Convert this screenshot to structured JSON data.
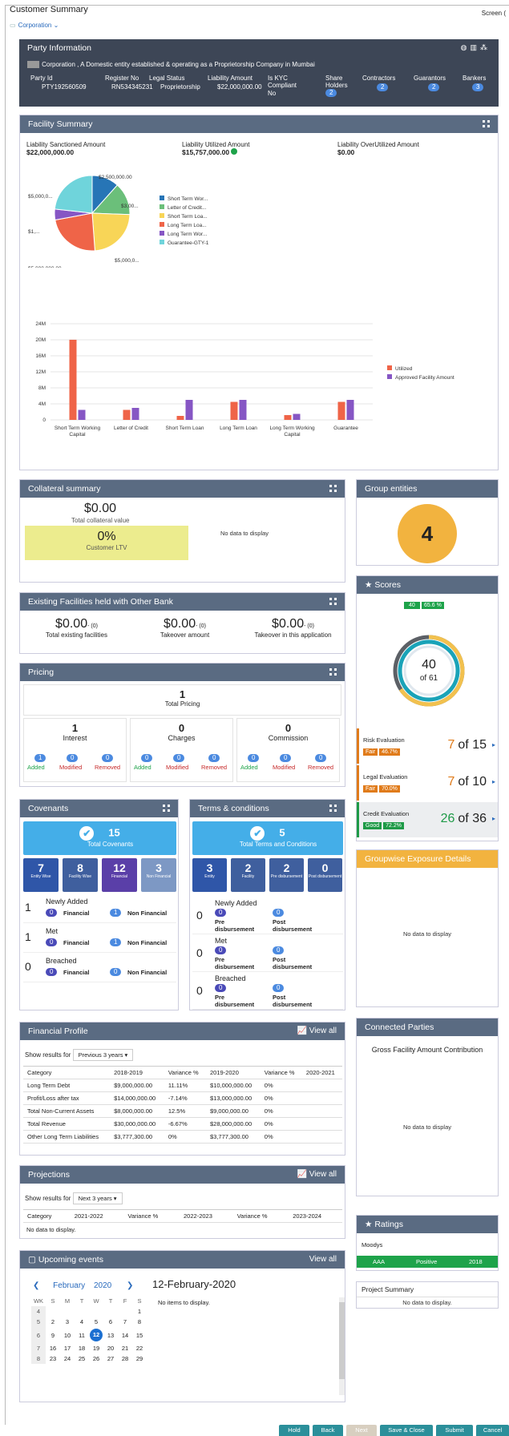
{
  "header": {
    "title": "Customer Summary",
    "screen_label": "Screen (",
    "breadcrumb": "Corporation"
  },
  "party": {
    "title": "Party Information",
    "description": "Corporation , A Domestic entity established & operating as a Proprietorship Company in Mumbai",
    "party_id_label": "Party Id",
    "party_id": "PTY192560509",
    "register_label": "Register No",
    "register_no": "RN534345231",
    "legal_label": "Legal Status",
    "legal_status": "Proprietorship",
    "liability_label": "Liability Amount",
    "liability_amount": "$22,000,000.00",
    "kyc_label": "Is KYC Compliant",
    "kyc_value": "No",
    "share_label": "Share Holders",
    "share_count": "2",
    "contractors_label": "Contractors",
    "contractors_count": "2",
    "guarantors_label": "Guarantors",
    "guarantors_count": "2",
    "bankers_label": "Bankers",
    "bankers_count": "3"
  },
  "facility": {
    "title": "Facility Summary",
    "sanctioned_label": "Liability Sanctioned Amount",
    "sanctioned": "$22,000,000.00",
    "utilized_label": "Liability Utilized Amount",
    "utilized": "$15,757,000.00",
    "over_label": "Liability OverUtilized Amount",
    "over": "$0.00"
  },
  "chart_data": [
    {
      "type": "pie",
      "categories": [
        "Short Term Wor...",
        "Letter of Credit...",
        "Short Term Loa...",
        "Long Term Loa...",
        "Long Term Wor...",
        "Guarantee-GTY-1"
      ],
      "values": [
        2500000,
        3000000,
        5000000,
        5000000,
        1000000,
        5000000
      ],
      "data_labels": [
        "$2,500,000.00",
        "$3,00...",
        "$5,000,0...",
        "$5,000,000.00",
        "$1,...",
        "$5,000,0..."
      ],
      "colors": [
        "#2775b6",
        "#6bbf7a",
        "#f8d557",
        "#ef6448",
        "#8656c4",
        "#6fd4db"
      ]
    },
    {
      "type": "bar",
      "categories": [
        "Short Term Working Capital",
        "Letter of Credit",
        "Short Term Loan",
        "Long Term Loan",
        "Long Term Working Capital",
        "Guarantee"
      ],
      "series": [
        {
          "name": "Utilized",
          "values": [
            20000000,
            2500000,
            1000000,
            4500000,
            1200000,
            4500000
          ],
          "color": "#ef6448"
        },
        {
          "name": "Approved Facility Amount",
          "values": [
            2500000,
            3000000,
            5000000,
            5000000,
            1500000,
            5000000
          ],
          "color": "#8656c4"
        }
      ],
      "yticks": [
        "0",
        "4M",
        "8M",
        "12M",
        "16M",
        "20M",
        "24M"
      ],
      "ylim": [
        0,
        24000000
      ]
    }
  ],
  "collateral": {
    "title": "Collateral summary",
    "value": "$0.00",
    "value_label": "Total collateral value",
    "ltv": "0%",
    "ltv_label": "Customer LTV",
    "no_data": "No data to display"
  },
  "group": {
    "title": "Group entities",
    "count": "4"
  },
  "existing": {
    "title": "Existing Facilities held with Other Bank",
    "items": [
      {
        "amount": "$0.00",
        "count": "- (0)",
        "label": "Total existing facilities"
      },
      {
        "amount": "$0.00",
        "count": "- (0)",
        "label": "Takeover amount"
      },
      {
        "amount": "$0.00",
        "count": "- (0)",
        "label": "Takeover in this application"
      }
    ]
  },
  "scores": {
    "title": "Scores",
    "chip_value": "40",
    "chip_pct": "65.6 %",
    "score": "40",
    "of": "of 61",
    "rows": [
      {
        "label": "Risk Evaluation",
        "grade": "Fair",
        "pct": "46.7%",
        "value": "7",
        "of": "of 15",
        "color": "#e07b1a"
      },
      {
        "label": "Legal Evaluation",
        "grade": "Fair",
        "pct": "70.0%",
        "value": "7",
        "of": "of 10",
        "color": "#e07b1a"
      },
      {
        "label": "Credit Evaluation",
        "grade": "Good",
        "pct": "72.2%",
        "value": "26",
        "of": "of 36",
        "color": "#1e9a47"
      }
    ]
  },
  "pricing": {
    "title": "Pricing",
    "total": "1",
    "total_label": "Total Pricing",
    "cols": [
      {
        "value": "1",
        "label": "Interest",
        "a": "1",
        "m": "0",
        "r": "0"
      },
      {
        "value": "0",
        "label": "Charges",
        "a": "0",
        "m": "0",
        "r": "0"
      },
      {
        "value": "0",
        "label": "Commission",
        "a": "0",
        "m": "0",
        "r": "0"
      }
    ],
    "added": "Added",
    "modified": "Modified",
    "removed": "Removed"
  },
  "covenants": {
    "title": "Covenants",
    "total": "15",
    "total_label": "Total Covenants",
    "tiles": [
      {
        "value": "7",
        "label": "Entity Wise",
        "color": "#2f56a8"
      },
      {
        "value": "8",
        "label": "Facility Wise",
        "color": "#3f5f9e"
      },
      {
        "value": "12",
        "label": "Financial",
        "color": "#5a3fa8"
      },
      {
        "value": "3",
        "label": "Non Financial",
        "color": "#7d98c4"
      }
    ],
    "rows": [
      {
        "num": "1",
        "label": "Newly Added",
        "f": "0",
        "fl": "Financial",
        "n": "1",
        "nl": "Non Financial"
      },
      {
        "num": "1",
        "label": "Met",
        "f": "0",
        "fl": "Financial",
        "n": "1",
        "nl": "Non Financial"
      },
      {
        "num": "0",
        "label": "Breached",
        "f": "0",
        "fl": "Financial",
        "n": "0",
        "nl": "Non Financial"
      }
    ]
  },
  "terms": {
    "title": "Terms & conditions",
    "total": "5",
    "total_label": "Total Terms and Conditions",
    "tiles": [
      {
        "value": "3",
        "label": "Entity",
        "color": "#2f56a8"
      },
      {
        "value": "2",
        "label": "Facility",
        "color": "#3f5f9e"
      },
      {
        "value": "2",
        "label": "Pre disbursement",
        "color": "#3f5f9e"
      },
      {
        "value": "0",
        "label": "Post disbursement",
        "color": "#3f5f9e"
      }
    ],
    "rows": [
      {
        "num": "0",
        "label": "Newly Added",
        "p": "0",
        "pl": "Pre disbursement",
        "q": "0",
        "ql": "Post disbursement"
      },
      {
        "num": "0",
        "label": "Met",
        "p": "0",
        "pl": "Pre disbursement",
        "q": "0",
        "ql": "Post disbursement"
      },
      {
        "num": "0",
        "label": "Breached",
        "p": "0",
        "pl": "Pre disbursement",
        "q": "0",
        "ql": "Post disbursement"
      }
    ]
  },
  "groupwise": {
    "title": "Groupwise Exposure Details",
    "no_data": "No data to display"
  },
  "financial": {
    "title": "Financial Profile",
    "view_all": "View all",
    "show_label": "Show results for",
    "period": "Previous 3 years",
    "headers": [
      "Category",
      "2018-2019",
      "Variance %",
      "2019-2020",
      "Variance %",
      "2020-2021"
    ],
    "rows": [
      [
        "Long Term Debt",
        "$9,000,000.00",
        "11.11%",
        "$10,000,000.00",
        "0%",
        ""
      ],
      [
        "Profit/Loss after tax",
        "$14,000,000.00",
        "-7.14%",
        "$13,000,000.00",
        "0%",
        ""
      ],
      [
        "Total Non-Current Assets",
        "$8,000,000.00",
        "12.5%",
        "$9,000,000.00",
        "0%",
        ""
      ],
      [
        "Total Revenue",
        "$30,000,000.00",
        "-6.67%",
        "$28,000,000.00",
        "0%",
        ""
      ],
      [
        "Other Long Term Liabilities",
        "$3,777,300.00",
        "0%",
        "$3,777,300.00",
        "0%",
        ""
      ]
    ]
  },
  "connected": {
    "title": "Connected Parties",
    "subtitle": "Gross Facility Amount Contribution",
    "no_data": "No data to display"
  },
  "projections": {
    "title": "Projections",
    "view_all": "View all",
    "show_label": "Show results for",
    "period": "Next 3 years",
    "headers": [
      "Category",
      "2021-2022",
      "Variance %",
      "2022-2023",
      "Variance %",
      "2023-2024"
    ],
    "no_data": "No data to display."
  },
  "ratings": {
    "title": "Ratings",
    "agency": "Moodys",
    "grade": "AAA",
    "outlook": "Positive",
    "year": "2018"
  },
  "project": {
    "title": "Project Summary",
    "no_data": "No data to display."
  },
  "events": {
    "title": "Upcoming events",
    "view_all": "View all",
    "month": "February",
    "year": "2020",
    "date": "12-February-2020",
    "no_items": "No items to display.",
    "dow": [
      "WK",
      "S",
      "M",
      "T",
      "W",
      "T",
      "F",
      "S"
    ],
    "weeks": [
      [
        "4",
        "",
        "",
        "",
        "",
        "",
        "",
        "1"
      ],
      [
        "5",
        "2",
        "3",
        "4",
        "5",
        "6",
        "7",
        "8"
      ],
      [
        "6",
        "9",
        "10",
        "11",
        "12",
        "13",
        "14",
        "15"
      ],
      [
        "7",
        "16",
        "17",
        "18",
        "19",
        "20",
        "21",
        "22"
      ],
      [
        "8",
        "23",
        "24",
        "25",
        "26",
        "27",
        "28",
        "29"
      ]
    ],
    "selected": "12"
  },
  "footer": {
    "hold": "Hold",
    "back": "Back",
    "next": "Next",
    "save_close": "Save & Close",
    "submit": "Submit",
    "cancel": "Cancel"
  }
}
